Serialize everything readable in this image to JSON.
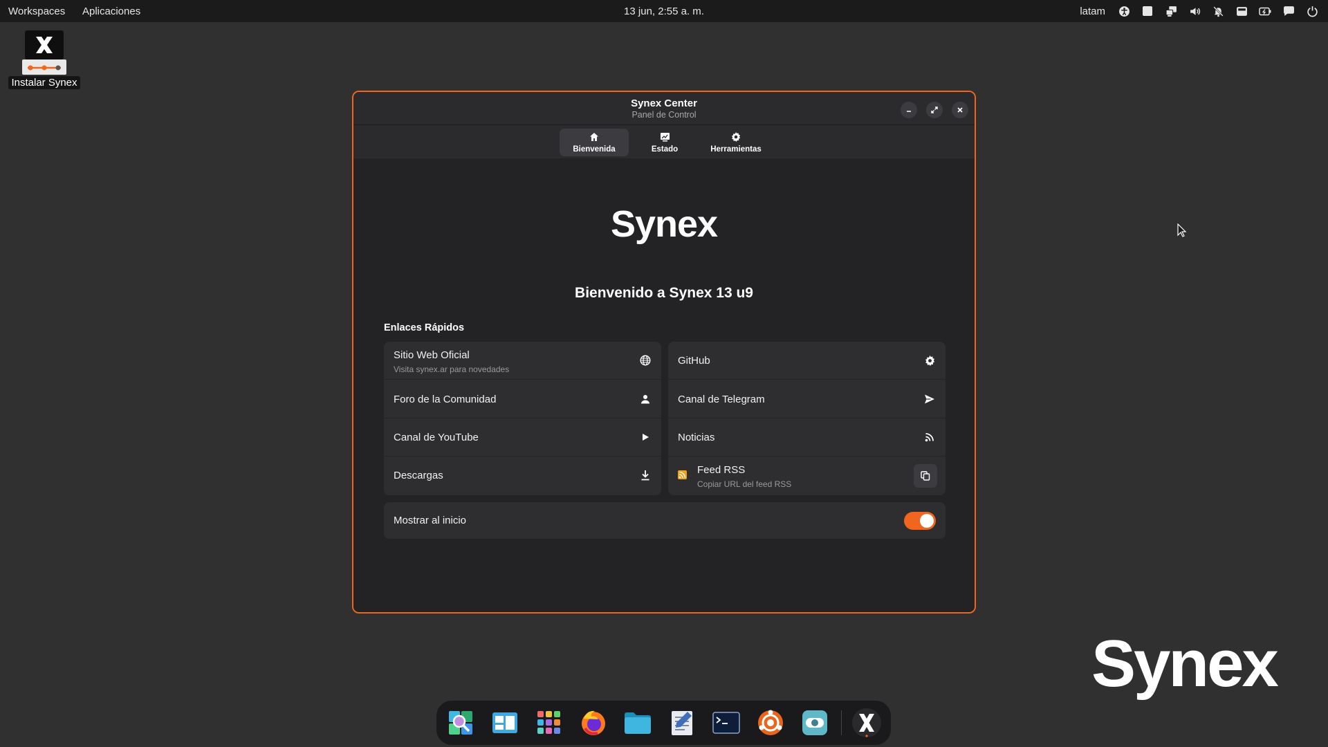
{
  "topbar": {
    "workspaces": "Workspaces",
    "applications": "Aplicaciones",
    "clock": "13 jun, 2:55 a. m.",
    "keyboard_layout": "latam",
    "tray_icons": [
      "accessibility-icon",
      "window-icon",
      "network-icon",
      "volume-icon",
      "notifications-off-icon",
      "screenshot-icon",
      "battery-icon",
      "chat-icon",
      "power-icon"
    ]
  },
  "desktop": {
    "install_icon_label": "Instalar Synex",
    "wallpaper_logo": "Synex"
  },
  "window": {
    "title": "Synex Center",
    "subtitle": "Panel de Control",
    "accent_color": "#f0661e",
    "tabs": [
      {
        "label": "Bienvenida",
        "icon": "home-icon",
        "active": true
      },
      {
        "label": "Estado",
        "icon": "monitor-chart-icon",
        "active": false
      },
      {
        "label": "Herramientas",
        "icon": "gear-icon",
        "active": false
      }
    ],
    "logo": "Synex",
    "welcome": "Bienvenido a Synex 13 u9",
    "quick_links_title": "Enlaces Rápidos",
    "left_links": [
      {
        "title": "Sitio Web Oficial",
        "subtitle": "Visita synex.ar para novedades",
        "icon": "globe-icon"
      },
      {
        "title": "Foro de la Comunidad",
        "icon": "person-icon"
      },
      {
        "title": "Canal de YouTube",
        "icon": "play-icon"
      },
      {
        "title": "Descargas",
        "icon": "download-icon"
      }
    ],
    "right_links": [
      {
        "title": "GitHub",
        "icon": "gear-icon"
      },
      {
        "title": "Canal de Telegram",
        "icon": "send-icon"
      },
      {
        "title": "Noticias",
        "icon": "rss-icon"
      },
      {
        "title": "Feed RSS",
        "subtitle": "Copiar URL del feed RSS",
        "icon": "copy-icon"
      }
    ],
    "startup_toggle": {
      "label": "Mostrar al inicio",
      "enabled": true
    }
  },
  "dock": {
    "apps": [
      "search-app-icon",
      "workspaces-app-icon",
      "app-grid-icon",
      "firefox-icon",
      "files-icon",
      "text-editor-icon",
      "terminal-icon",
      "software-store-icon",
      "settings-toggle-icon",
      "synex-icon"
    ]
  }
}
